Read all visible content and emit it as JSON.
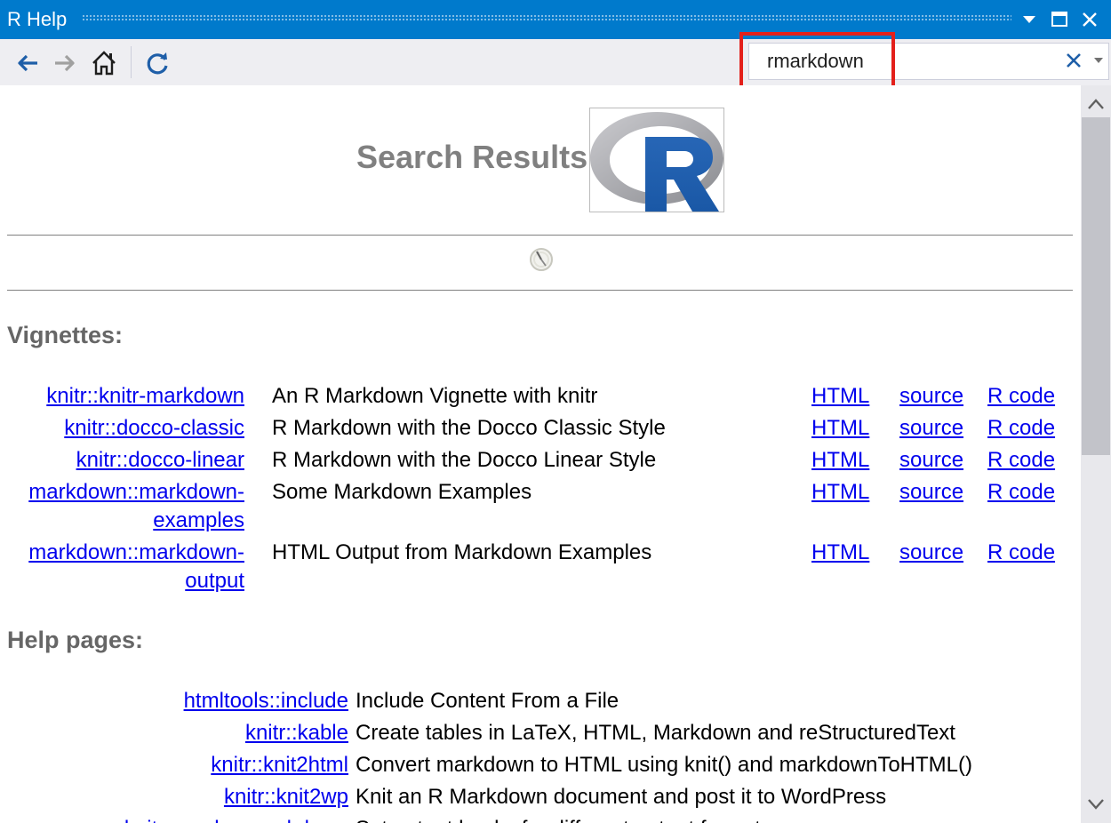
{
  "window": {
    "title": "R Help"
  },
  "toolbar": {
    "back": "back-icon",
    "forward": "forward-icon",
    "home": "home-icon",
    "refresh": "refresh-icon"
  },
  "search": {
    "value": "rmarkdown"
  },
  "page": {
    "title": "Search Results",
    "logo_alt": "R"
  },
  "vignettes": {
    "heading": "Vignettes:",
    "rows": [
      {
        "link": "knitr::knitr-markdown",
        "desc": "An R Markdown Vignette with knitr",
        "html": "HTML",
        "source": "source",
        "rcode": "R code"
      },
      {
        "link": "knitr::docco-classic",
        "desc": "R Markdown with the Docco Classic Style",
        "html": "HTML",
        "source": "source",
        "rcode": "R code"
      },
      {
        "link": "knitr::docco-linear",
        "desc": "R Markdown with the Docco Linear Style",
        "html": "HTML",
        "source": "source",
        "rcode": "R code"
      },
      {
        "link_line1": "markdown::markdown-",
        "link_line2": "examples",
        "desc": "Some Markdown Examples",
        "html": "HTML",
        "source": "source",
        "rcode": "R code"
      },
      {
        "link_line1": "markdown::markdown-",
        "link_line2": "output",
        "desc": "HTML Output from Markdown Examples",
        "html": "HTML",
        "source": "source",
        "rcode": "R code"
      }
    ]
  },
  "help_pages": {
    "heading": "Help pages:",
    "rows": [
      {
        "link": "htmltools::include",
        "desc": "Include Content From a File"
      },
      {
        "link": "knitr::kable",
        "desc": "Create tables in LaTeX, HTML, Markdown and reStructuredText"
      },
      {
        "link": "knitr::knit2html",
        "desc": "Convert markdown to HTML using knit() and markdownToHTML()"
      },
      {
        "link": "knitr::knit2wp",
        "desc": "Knit an R Markdown document and post it to WordPress"
      },
      {
        "link": "knitr::render_markdown",
        "desc": "Set output hooks for different output formats"
      }
    ]
  },
  "colors": {
    "titlebar": "#007acc",
    "link": "#0000ee",
    "highlight": "#e3201b",
    "heading": "#666666"
  }
}
